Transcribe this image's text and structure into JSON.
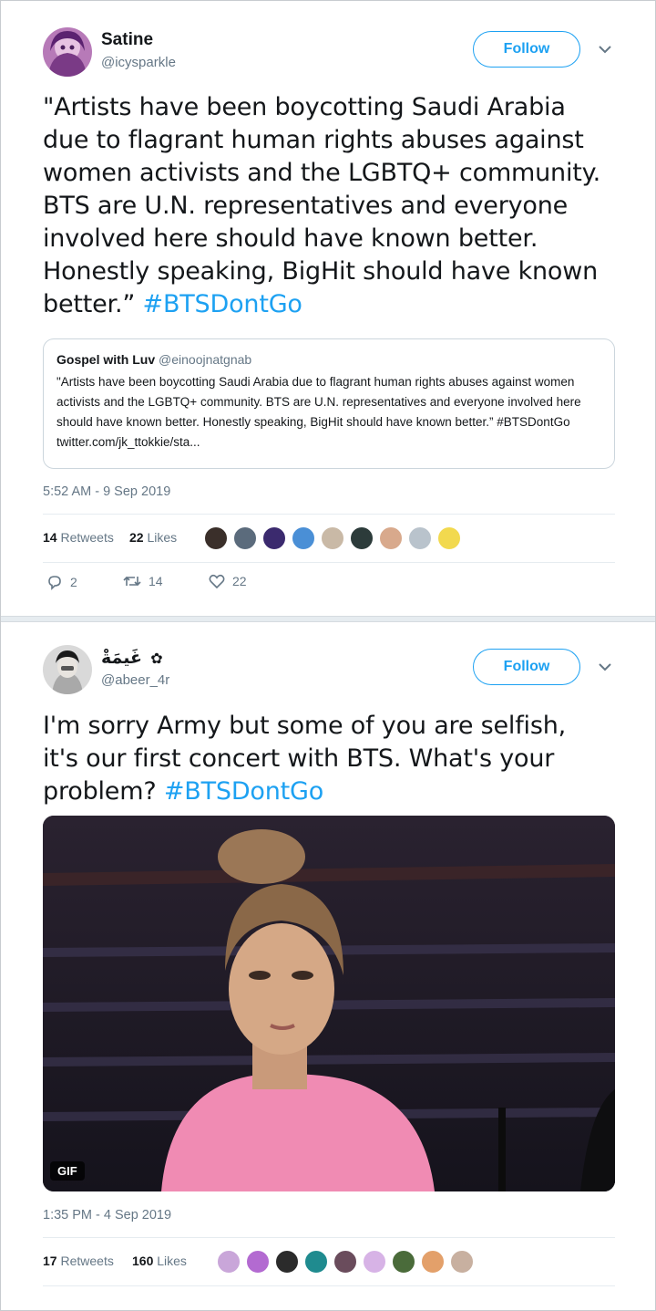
{
  "tweets": [
    {
      "user": {
        "name": "Satine",
        "handle": "@icysparkle"
      },
      "follow_label": "Follow",
      "text_lines": [
        "\"Artists have been boycotting Saudi Arabia",
        "due to flagrant human rights abuses against",
        "women activists and the LGBTQ+ community.",
        "BTS are U.N. representatives and everyone",
        "involved here should have known better.",
        "Honestly speaking, BigHit should have known"
      ],
      "text_last": "better.” ",
      "hashtag": "#BTSDontGo",
      "quote": {
        "name": "Gospel with Luv",
        "handle": "@einoojnatgnab",
        "body": "\"Artists have been boycotting Saudi Arabia due to flagrant human rights abuses against women activists and the LGBTQ+ community. BTS are U.N. representatives and everyone involved here should have known better. Honestly speaking, BigHit should have known better.” #BTSDontGo twitter.com/jk_ttokkie/sta..."
      },
      "timestamp": "5:52 AM - 9 Sep 2019",
      "retweets_count": "14",
      "retweets_label": "Retweets",
      "likes_count": "22",
      "likes_label": "Likes",
      "liker_colors": [
        "#3a2f2a",
        "#5b6b7c",
        "#3b2a6e",
        "#4a8fd6",
        "#c9b9a6",
        "#2c3b3a",
        "#d8a98c",
        "#b9c3cc",
        "#f2d94e"
      ],
      "actions": {
        "replies": "2",
        "retweets": "14",
        "likes": "22"
      }
    },
    {
      "user": {
        "name": "غَيمَةْ",
        "handle": "@abeer_4r"
      },
      "follow_label": "Follow",
      "text_lines": [
        "I'm sorry Army but some of you are selfish,",
        "it's our first concert with BTS. What's your"
      ],
      "text_last": "problem? ",
      "hashtag": "#BTSDontGo",
      "gif_label": "GIF",
      "timestamp": "1:35 PM - 4 Sep 2019",
      "retweets_count": "17",
      "retweets_label": "Retweets",
      "likes_count": "160",
      "likes_label": "Likes",
      "liker_colors": [
        "#c9a6d9",
        "#b36ad1",
        "#2b2b2b",
        "#1f8b8f",
        "#6a4c5c",
        "#d7b3e6",
        "#4a6b3a",
        "#e3a06a",
        "#c8b0a0"
      ]
    }
  ]
}
